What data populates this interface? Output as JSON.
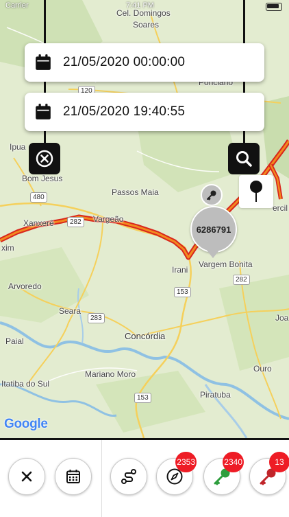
{
  "status_bar": {
    "carrier": "Carrier",
    "time": "7:41 PM"
  },
  "date_filter": {
    "start": "21/05/2020 00:00:00",
    "end": "21/05/2020 19:40:55"
  },
  "map": {
    "places": [
      {
        "name": "Cel. Domingos",
        "id": "domingos-1"
      },
      {
        "name": "Soares",
        "id": "domingos-2"
      },
      {
        "name": "Ponciano",
        "id": "ponciano"
      },
      {
        "name": "Ipua",
        "id": "ipua"
      },
      {
        "name": "Bom Jesus",
        "id": "bom-jesus"
      },
      {
        "name": "Passos Maia",
        "id": "passos-maia"
      },
      {
        "name": "Xanxerê",
        "id": "xanxere"
      },
      {
        "name": "Vargeão",
        "id": "vargeao"
      },
      {
        "name": "xim",
        "id": "xim"
      },
      {
        "name": "Irani",
        "id": "irani"
      },
      {
        "name": "Vargem Bonita",
        "id": "vargem-bonita"
      },
      {
        "name": "Arvoredo",
        "id": "arvoredo"
      },
      {
        "name": "Seara",
        "id": "seara"
      },
      {
        "name": "Joa",
        "id": "joa"
      },
      {
        "name": "Concórdia",
        "id": "concordia"
      },
      {
        "name": "Paial",
        "id": "paial"
      },
      {
        "name": "Ouro",
        "id": "ouro"
      },
      {
        "name": "Itatiba do Sul",
        "id": "itatiba"
      },
      {
        "name": "Mariano Moro",
        "id": "mariano-moro"
      },
      {
        "name": "Piratuba",
        "id": "piratuba"
      },
      {
        "name": "ercil",
        "id": "ercil"
      }
    ],
    "roads": [
      "120",
      "480",
      "282",
      "282",
      "153",
      "283",
      "282",
      "153"
    ],
    "vehicle_id": "6286791",
    "attribution": "Google",
    "route_color": "#d9261c"
  },
  "toolbar": {
    "counts": {
      "route": "2353",
      "active": "2340",
      "inactive": "13"
    },
    "colors": {
      "active_key": "#2e9e3e",
      "inactive_key": "#c0252a",
      "badge": "#ee1c25"
    }
  }
}
